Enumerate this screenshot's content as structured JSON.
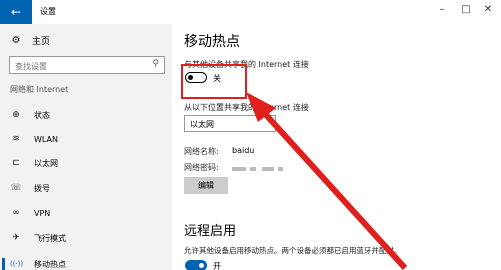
{
  "window": {
    "title": "设置",
    "back_glyph": "←",
    "minimize_glyph": "–",
    "maximize_glyph": "□",
    "close_glyph": "✕"
  },
  "sidebar": {
    "home_label": "主页",
    "search_placeholder": "查找设置",
    "section_title": "网络和 Internet",
    "items": [
      {
        "label": "状态",
        "icon": "globe-icon",
        "glyph": "⊕"
      },
      {
        "label": "WLAN",
        "icon": "wifi-icon",
        "glyph": "≋"
      },
      {
        "label": "以太网",
        "icon": "ethernet-icon",
        "glyph": "⊏"
      },
      {
        "label": "拨号",
        "icon": "dialup-icon",
        "glyph": "☏"
      },
      {
        "label": "VPN",
        "icon": "vpn-icon",
        "glyph": "∞"
      },
      {
        "label": "飞行模式",
        "icon": "airplane-icon",
        "glyph": "✈"
      },
      {
        "label": "移动热点",
        "icon": "hotspot-icon",
        "glyph": "((·))",
        "active": true
      }
    ]
  },
  "main": {
    "title": "移动热点",
    "share_label": "与其他设备共享我的 Internet 连接",
    "share_toggle_state": "关",
    "source_label": "从以下位置共享我的 Internet 连接",
    "source_value": "以太网",
    "network_name_label": "网络名称:",
    "network_name_value": "baidu",
    "network_password_label": "网络密码:",
    "edit_button": "编辑",
    "remote_title": "远程启用",
    "remote_desc": "允许其他设备启用移动热点。两个设备必须都已启用蓝牙并配对。",
    "remote_toggle_state": "开"
  },
  "colors": {
    "accent": "#0063b1",
    "annotation": "#e0201c",
    "sidebar_bg": "#f2f2f2"
  }
}
